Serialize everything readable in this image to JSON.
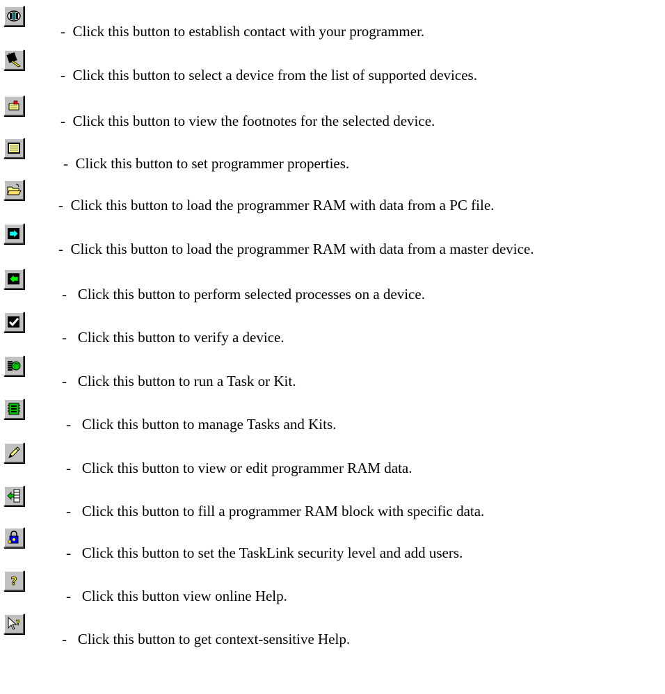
{
  "items": [
    {
      "icon": "connect-icon",
      "text": "Click this button to establish contact with your programmer."
    },
    {
      "icon": "select-device-icon",
      "text": "Click this button to select a device from the list of supported devices."
    },
    {
      "icon": "footnotes-icon",
      "text": "Click this button to view the footnotes for the selected device."
    },
    {
      "icon": "programmer-properties-icon",
      "text": "Click this button to set programmer properties."
    },
    {
      "icon": "open-folder-icon",
      "text": "Click this button to load the programmer RAM with data from a PC file."
    },
    {
      "icon": "load-from-master-icon",
      "text": "Click this button to load the programmer RAM with data from a master device."
    },
    {
      "icon": "program-device-icon",
      "text": "Click this button to perform selected processes on a device."
    },
    {
      "icon": "verify-checkmark-icon",
      "text": "Click this button to verify a device."
    },
    {
      "icon": "run-task-icon",
      "text": "Click this button to run a Task or Kit."
    },
    {
      "icon": "manage-tasks-icon",
      "text": "Click this button to manage Tasks and Kits."
    },
    {
      "icon": "edit-pencil-icon",
      "text": "Click this button to view or edit programmer RAM data."
    },
    {
      "icon": "fill-block-icon",
      "text": "Click this button to fill a programmer RAM block with specific data."
    },
    {
      "icon": "security-icon",
      "text": "Click this button to set the TaskLink security level and add users."
    },
    {
      "icon": "help-icon",
      "text": "Click this button view online Help."
    },
    {
      "icon": "context-help-icon",
      "text": "Click this button to get context-sensitive Help."
    }
  ]
}
